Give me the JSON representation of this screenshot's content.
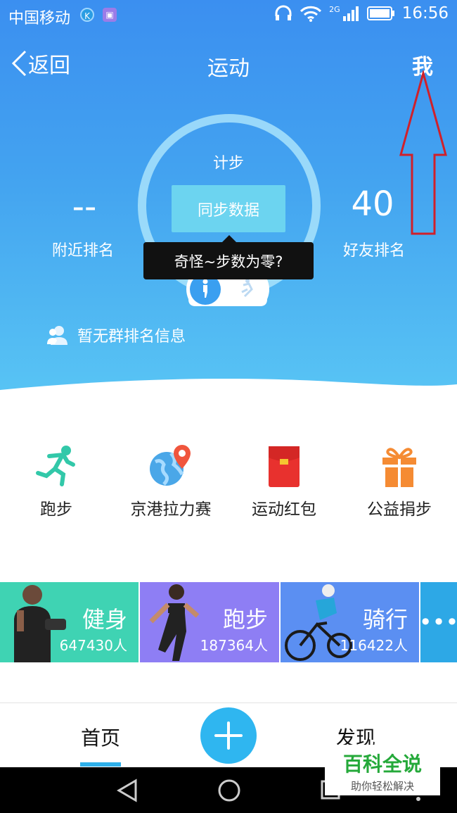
{
  "status_bar": {
    "carrier": "中国移动",
    "network": "2G",
    "time": "16:56"
  },
  "header": {
    "back_label": "返回",
    "title": "运动",
    "me_label": "我"
  },
  "pedometer": {
    "mode_label": "计步",
    "sync_button": "同步数据",
    "nearby_rank_value": "--",
    "nearby_rank_label": "附近排名",
    "friend_rank_value": "40",
    "friend_rank_label": "好友排名",
    "tooltip": "奇怪~步数为零?"
  },
  "group_rank": {
    "text": "暂无群排名信息"
  },
  "quick_entries": [
    {
      "label": "跑步",
      "icon": "running-person-icon"
    },
    {
      "label": "京港拉力赛",
      "icon": "globe-pin-icon"
    },
    {
      "label": "运动红包",
      "icon": "red-envelope-icon"
    },
    {
      "label": "公益捐步",
      "icon": "gift-icon"
    }
  ],
  "cards": [
    {
      "title": "健身",
      "count": "647430人",
      "color": "#3fd3b3"
    },
    {
      "title": "跑步",
      "count": "187364人",
      "color": "#8e7ef4"
    },
    {
      "title": "骑行",
      "count": "116422人",
      "color": "#5b8ff2"
    }
  ],
  "more_label": "•••",
  "tabbar": {
    "home": "首页",
    "discover": "发现"
  },
  "watermark": {
    "title": "百科全说",
    "subtitle": "助你轻松解决"
  },
  "colors": {
    "accent": "#2fb6f0",
    "arrow": "#d0202a"
  }
}
